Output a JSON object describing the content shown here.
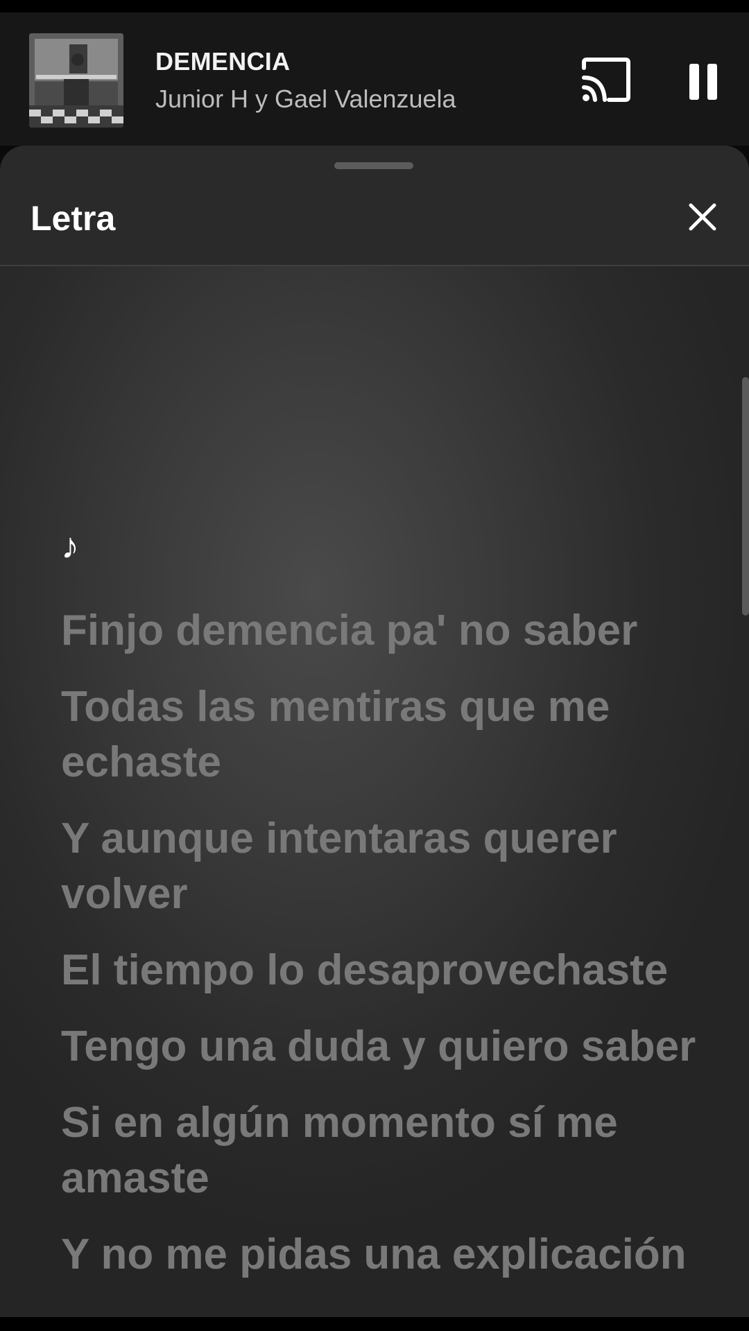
{
  "now_playing": {
    "title": "DEMENCIA",
    "artist": "Junior H y Gael Valenzuela",
    "album_art_icon": "album-cover-image",
    "cast_icon": "cast-icon",
    "pause_icon": "pause-icon"
  },
  "lyrics_sheet": {
    "title": "Letra",
    "close_icon": "close-icon",
    "music_note": "♪",
    "lines": [
      "Finjo demencia pa' no saber",
      "Todas las mentiras que me echaste",
      "Y aunque intentaras querer volver",
      "El tiempo lo desaprovechaste",
      "Tengo una duda y quiero saber",
      "Si en algún momento sí me amaste",
      "Y no me pidas una explicación"
    ]
  },
  "colors": {
    "mini_player_bg": "#171717",
    "sheet_bg": "#2a2a2a",
    "lyric_text": "#797979",
    "active_text": "#ffffff"
  }
}
